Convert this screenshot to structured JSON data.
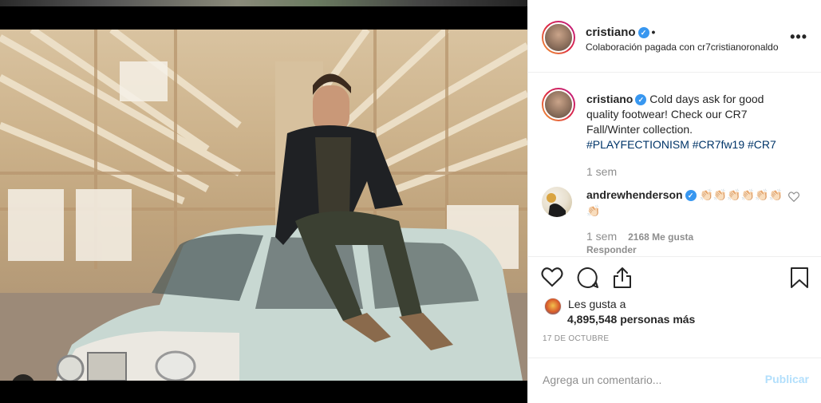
{
  "post": {
    "username": "cristiano",
    "header_dot": "•",
    "collab_prefix": "Colaboración pagada con",
    "collab_partner": "cr7cristianoronaldo",
    "more_icon": "more-horizontal-icon"
  },
  "caption": {
    "username": "cristiano",
    "text": "Cold days ask for good quality footwear! Check our CR7 Fall/Winter collection.",
    "hashtags": "#PLAYFECTIONISM #CR7fw19 #CR7",
    "time": "1 sem"
  },
  "comment": {
    "username": "andrewhenderson",
    "text": "👏🏻👏🏻👏🏻👏🏻👏🏻👏🏻👏🏻",
    "time": "1 sem",
    "likes": "2168 Me gusta",
    "reply": "Responder"
  },
  "likes": {
    "line1": "Les gusta a",
    "count": "4,895,548",
    "suffix": "personas más"
  },
  "date": "17 DE OCTUBRE",
  "add_comment": {
    "placeholder": "Agrega un comentario...",
    "button": "Publicar"
  },
  "colors": {
    "verified": "#3897f0",
    "hashtag": "#003569",
    "muted": "#8e8e8e",
    "publish_disabled": "#b2dffc"
  }
}
